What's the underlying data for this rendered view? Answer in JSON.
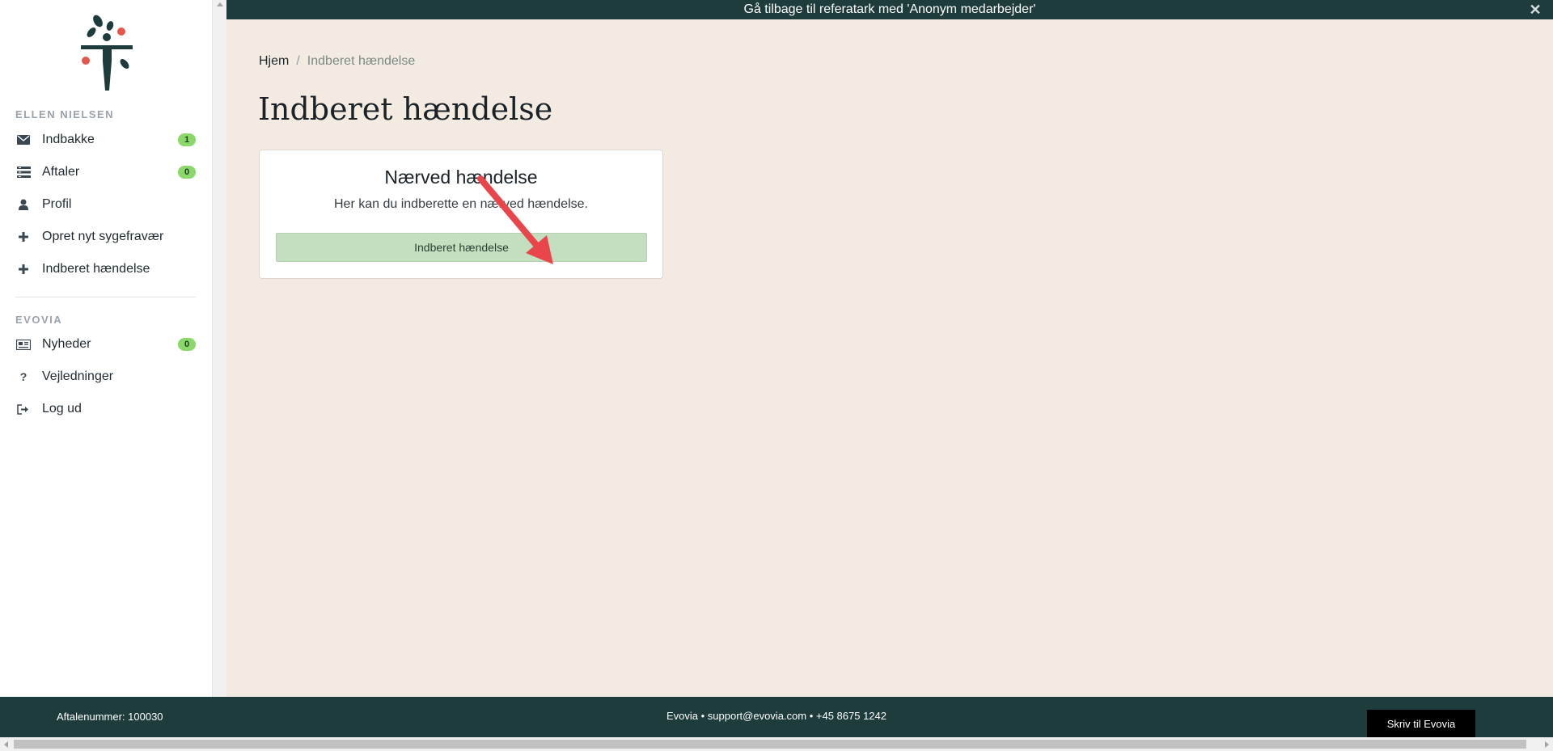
{
  "banner": {
    "text": "Gå tilbage til referatark med 'Anonym medarbejder'"
  },
  "sidebar": {
    "user_section": "ELLEN NIELSEN",
    "user_items": [
      {
        "label": "Indbakke",
        "icon": "envelope-icon",
        "badge": "1"
      },
      {
        "label": "Aftaler",
        "icon": "list-icon",
        "badge": "0"
      },
      {
        "label": "Profil",
        "icon": "user-icon"
      },
      {
        "label": "Opret nyt sygefravær",
        "icon": "plus-icon"
      },
      {
        "label": "Indberet hændelse",
        "icon": "plus-icon"
      }
    ],
    "org_section": "EVOVIA",
    "org_items": [
      {
        "label": "Nyheder",
        "icon": "newspaper-icon",
        "badge": "0"
      },
      {
        "label": "Vejledninger",
        "icon": "question-icon"
      },
      {
        "label": "Log ud",
        "icon": "logout-icon"
      }
    ]
  },
  "breadcrumb": {
    "home": "Hjem",
    "separator": "/",
    "current": "Indberet hændelse"
  },
  "page": {
    "title": "Indberet hændelse"
  },
  "card": {
    "title": "Nærved hændelse",
    "text": "Her kan du indberette en nærved hændelse.",
    "button": "Indberet hændelse"
  },
  "footer": {
    "agreement": "Aftalenummer: 100030",
    "contact": "Evovia • support@evovia.com • +45 8675 1242",
    "write_button": "Skriv til Evovia"
  },
  "colors": {
    "brand_dark": "#1e3c3c",
    "background": "#f3ebe1",
    "badge": "#8bd86a",
    "button_green": "#c4dfc0",
    "annotation_arrow": "#e8464a"
  }
}
